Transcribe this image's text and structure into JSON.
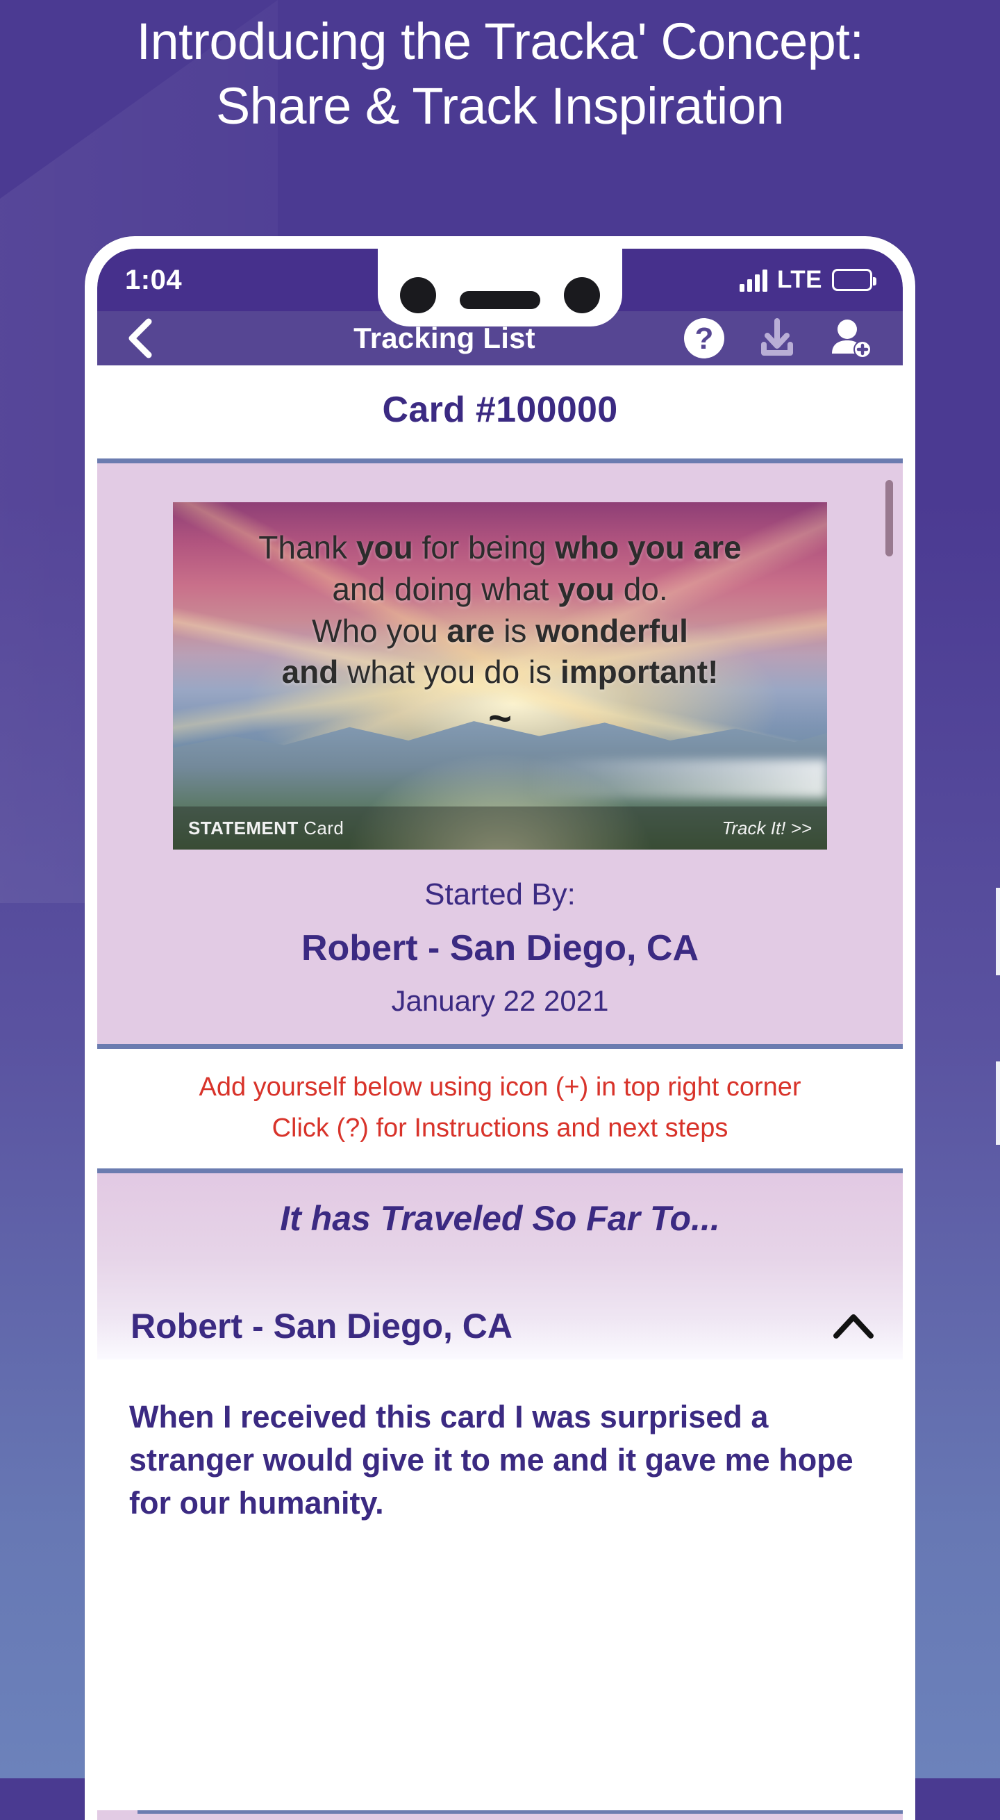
{
  "headline": {
    "line1": "Introducing the Tracka' Concept:",
    "line2": "Share & Track Inspiration"
  },
  "colors": {
    "background_top": "#4b3a92",
    "background_bottom": "#6c82bb",
    "status_bar": "#46308c",
    "nav_bar": "#564693",
    "brand_purple": "#3b2a82",
    "alert_red": "#d8332a",
    "card_panel": "#e2cbe4",
    "divider_blue": "#6b7cb0"
  },
  "status_bar": {
    "time": "1:04",
    "network": "LTE",
    "signal_icon": "signal-bars-icon",
    "battery_icon": "battery-full-icon"
  },
  "nav": {
    "back_icon": "chevron-left-icon",
    "title": "Tracking List",
    "help_icon": "help-question-icon",
    "download_icon": "download-icon",
    "add_person_icon": "add-person-icon"
  },
  "card": {
    "title": "Card #100000",
    "quote": {
      "line1_a": "Thank ",
      "line1_b": "you",
      "line1_c": " for being ",
      "line1_d": "who you are",
      "line2_a": "and doing what ",
      "line2_b": "you",
      "line2_c": " do.",
      "line3_a": "Who you ",
      "line3_b": "are",
      "line3_c": " is ",
      "line3_d": "wonderful",
      "line4_a": "and",
      "line4_b": " what you do is ",
      "line4_c": "important!",
      "tilde": "~"
    },
    "brand_bold": "STATEMENT",
    "brand_rest": " Card",
    "track_it": "Track It! >>",
    "started_by_label": "Started By:",
    "starter_name": "Robert - San Diego, CA",
    "starter_date": "January 22 2021"
  },
  "instructions": {
    "line1": "Add yourself below using icon (+) in top right corner",
    "line2": "Click (?) for Instructions and next steps"
  },
  "traveled": {
    "title": "It has Traveled So Far To...",
    "entries": [
      {
        "name": "Robert - San Diego, CA",
        "expand_icon": "chevron-up-icon",
        "message": "When I received this card I was surprised a stranger would give it to me and it gave me hope for our humanity."
      }
    ]
  }
}
